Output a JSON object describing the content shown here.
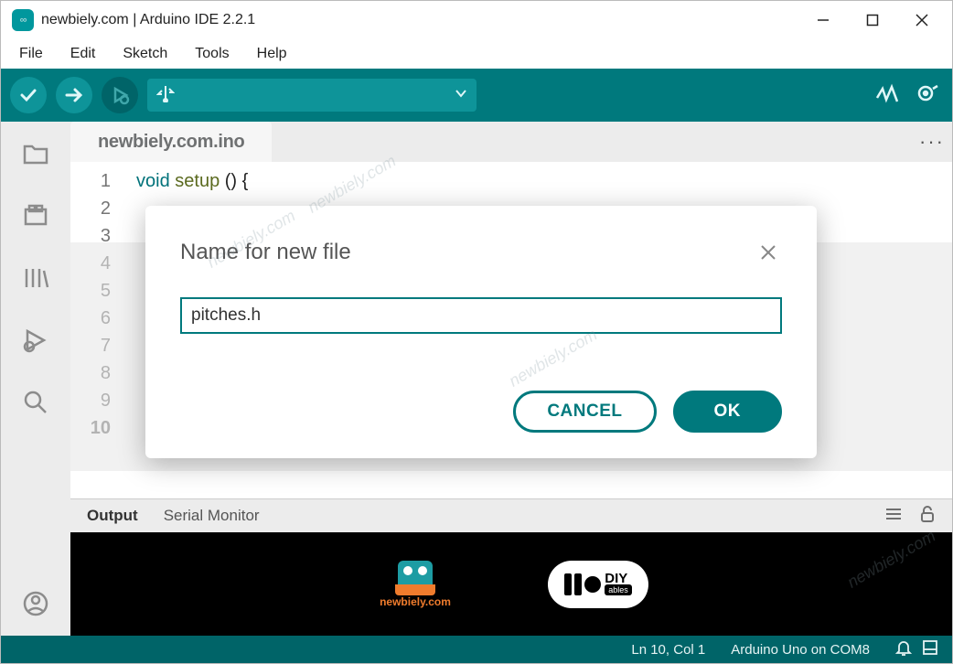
{
  "window": {
    "title": "newbiely.com | Arduino IDE 2.2.1"
  },
  "menu": {
    "file": "File",
    "edit": "Edit",
    "sketch": "Sketch",
    "tools": "Tools",
    "help": "Help"
  },
  "tab": {
    "filename": "newbiely.com.ino",
    "more": "···"
  },
  "code": {
    "line1_kw": "void",
    "line1_fn": "setup",
    "line1_rest": "() {"
  },
  "gutter": {
    "l1": "1",
    "l2": "2",
    "l3": "3",
    "l4": "4",
    "l5": "5",
    "l6": "6",
    "l7": "7",
    "l8": "8",
    "l9": "9",
    "l10": "10"
  },
  "output": {
    "tab_output": "Output",
    "tab_serial": "Serial Monitor"
  },
  "status": {
    "pos": "Ln 10, Col 1",
    "board": "Arduino Uno on COM8"
  },
  "dialog": {
    "title": "Name for new file",
    "value": "pitches.h",
    "cancel": "CANCEL",
    "ok": "OK"
  },
  "logos": {
    "site": "newbiely.com",
    "diy": "DIY",
    "ables": "ables"
  },
  "watermark": "newbiely.com"
}
